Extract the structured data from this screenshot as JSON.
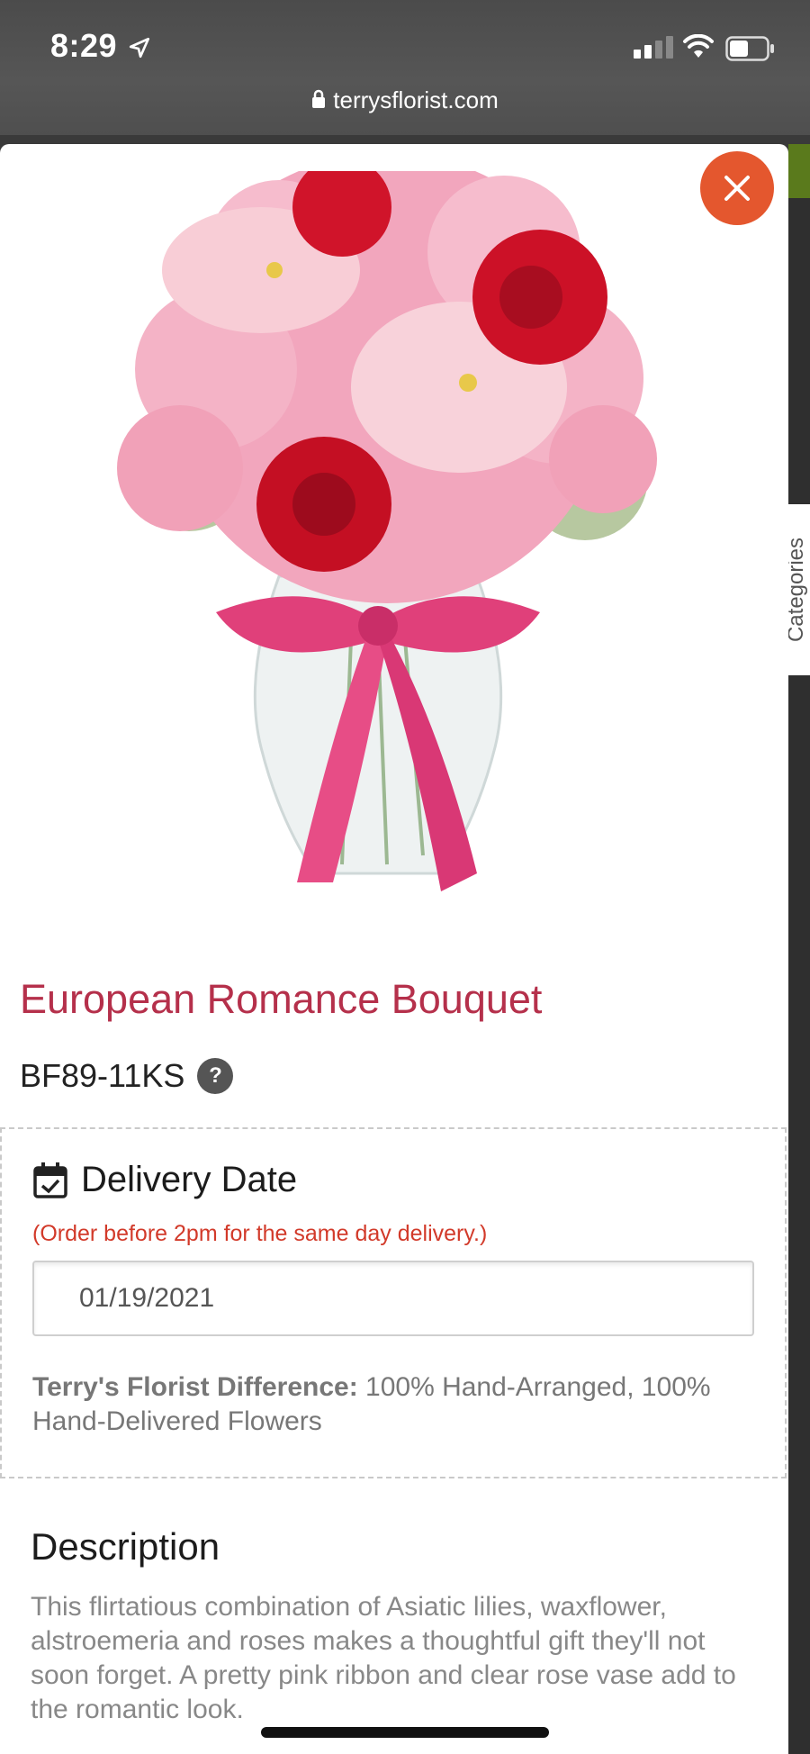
{
  "status_bar": {
    "time": "8:29",
    "url": "terrysflorist.com"
  },
  "side_tab": {
    "label": "Categories"
  },
  "product": {
    "title": "European Romance Bouquet",
    "sku": "BF89-11KS",
    "help_glyph": "?"
  },
  "delivery": {
    "title": "Delivery Date",
    "note": "(Order before 2pm for the same day delivery.)",
    "date_value": "01/19/2021",
    "difference_label": "Terry's Florist Difference:",
    "difference_text": " 100% Hand-Arranged, 100% Hand-Delivered Flowers"
  },
  "description": {
    "title": "Description",
    "text": "This flirtatious combination of Asiatic lilies, waxflower, alstroemeria and roses makes a thoughtful gift they'll not soon forget. A pretty pink ribbon and clear rose vase add to the romantic look."
  },
  "colors": {
    "accent_title": "#b5304b",
    "close_button": "#e4572e",
    "note_red": "#d23a2a"
  },
  "icons": [
    "location-arrow-icon",
    "signal-icon",
    "wifi-icon",
    "battery-icon",
    "lock-icon",
    "close-icon",
    "help-icon",
    "calendar-check-icon"
  ]
}
